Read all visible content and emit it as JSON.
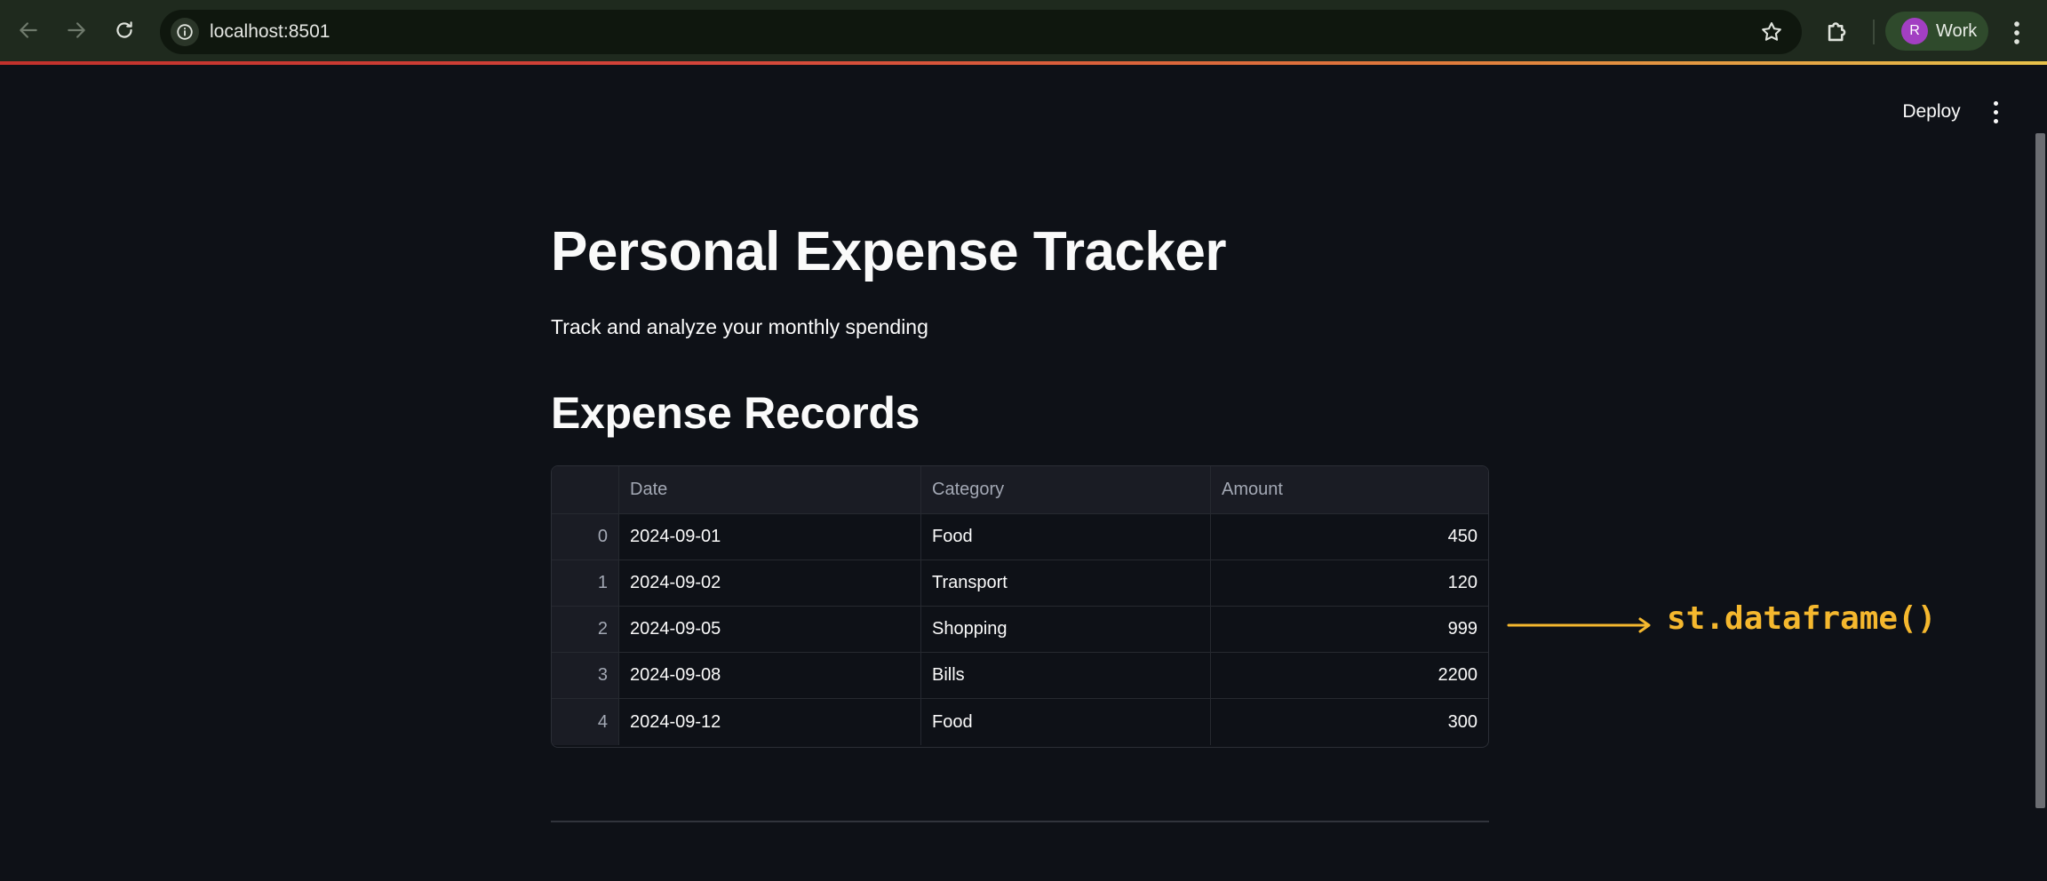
{
  "browser": {
    "url": "localhost:8501",
    "profile_initial": "R",
    "profile_label": "Work"
  },
  "app": {
    "deploy_label": "Deploy"
  },
  "main": {
    "title": "Personal Expense Tracker",
    "subtitle": "Track and analyze your monthly spending",
    "section_title": "Expense Records",
    "table": {
      "columns": [
        "",
        "Date",
        "Category",
        "Amount"
      ],
      "rows": [
        {
          "index": "0",
          "date": "2024-09-01",
          "category": "Food",
          "amount": "450"
        },
        {
          "index": "1",
          "date": "2024-09-02",
          "category": "Transport",
          "amount": "120"
        },
        {
          "index": "2",
          "date": "2024-09-05",
          "category": "Shopping",
          "amount": "999"
        },
        {
          "index": "3",
          "date": "2024-09-08",
          "category": "Bills",
          "amount": "2200"
        },
        {
          "index": "4",
          "date": "2024-09-12",
          "category": "Food",
          "amount": "300"
        }
      ]
    }
  },
  "annotation": {
    "label": "st.dataframe()",
    "color": "#f5b82e"
  },
  "colors": {
    "background": "#0e1117",
    "chrome": "#1f2a1e",
    "avatar": "#a23fc2"
  }
}
